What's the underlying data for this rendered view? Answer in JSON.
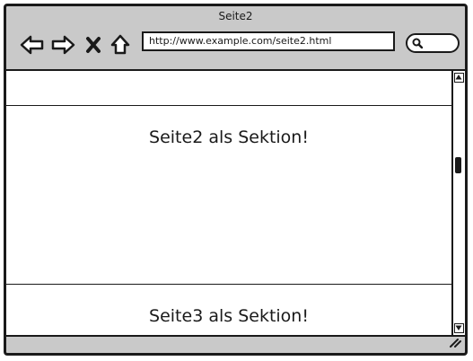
{
  "window": {
    "title": "Seite2"
  },
  "address_bar": {
    "url": "http://www.example.com/seite2.html"
  },
  "content": {
    "sections": [
      {
        "label": "Seite2 als Sektion!"
      },
      {
        "label": "Seite3 als Sektion!"
      }
    ]
  },
  "icons": {
    "back": "back-arrow-icon",
    "forward": "forward-arrow-icon",
    "stop": "close-icon",
    "home": "home-icon",
    "search": "search-icon",
    "resize": "resize-grip-icon"
  }
}
